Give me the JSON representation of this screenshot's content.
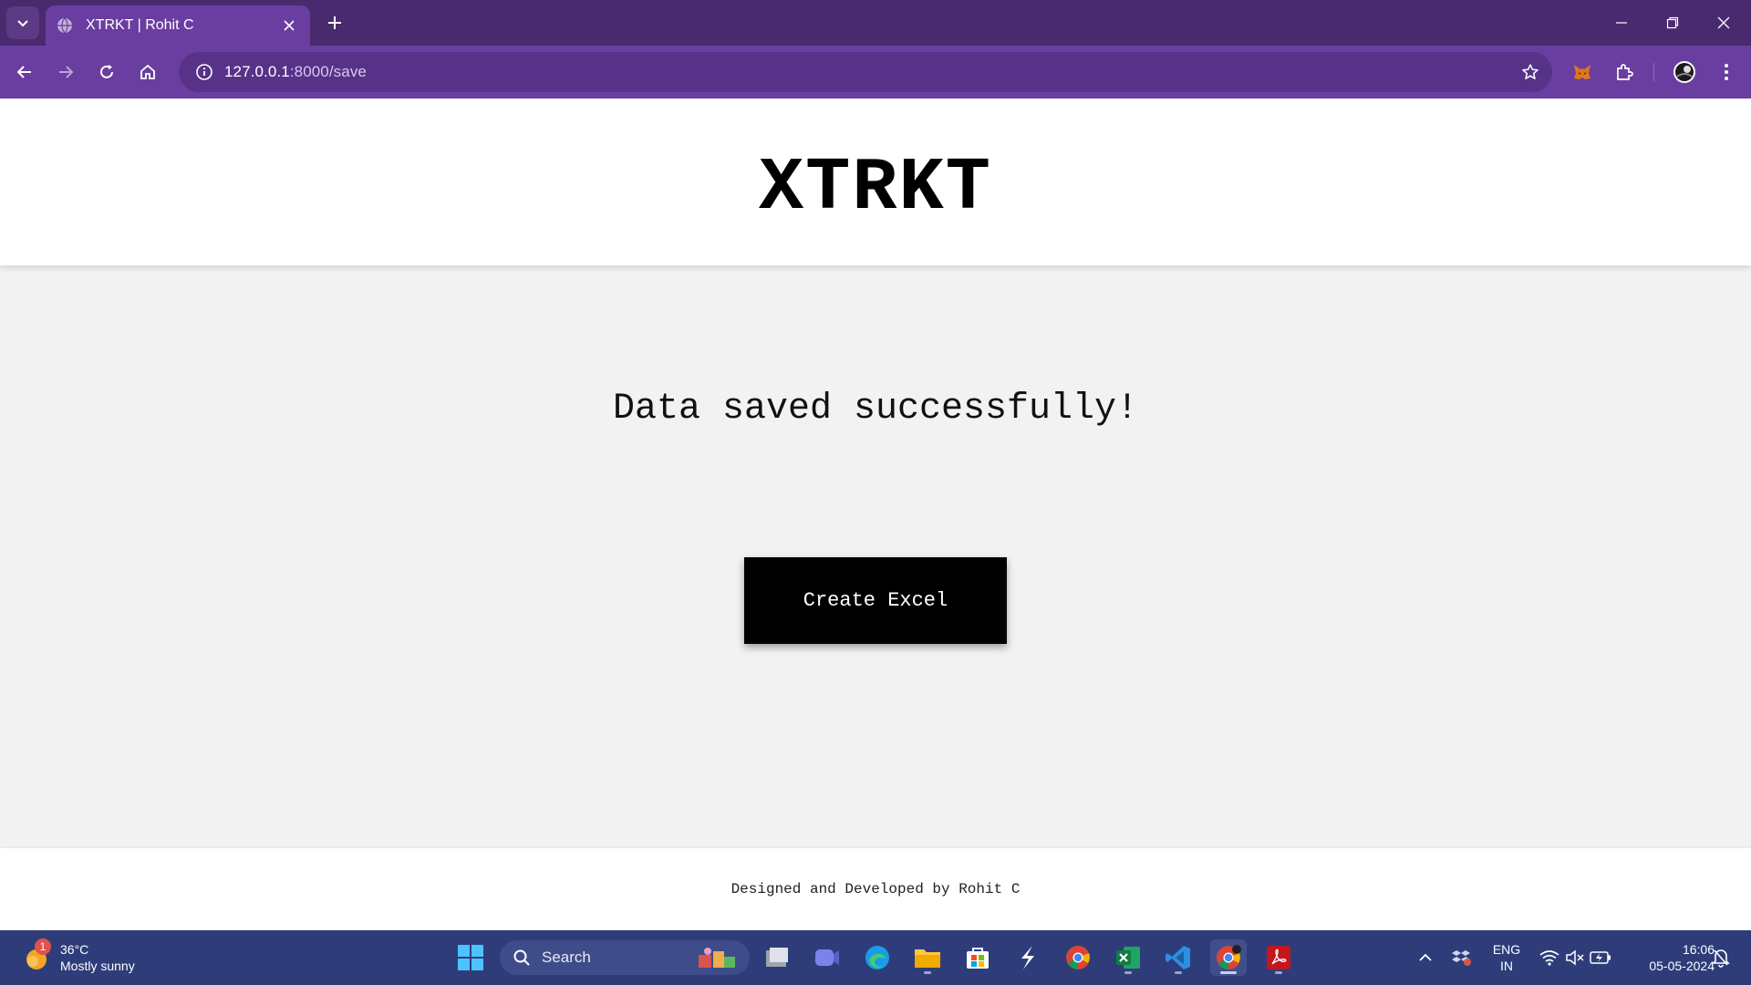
{
  "browser": {
    "tab_title": "XTRKT | Rohit C",
    "url_host": "127.0.0.1",
    "url_path": ":8000/save",
    "theme_colors": {
      "tabstrip": "#4a2a6e",
      "toolbar": "#6a3ea0",
      "omnibox": "#573289"
    },
    "icons": [
      "tab-search-icon",
      "globe-icon",
      "close-icon",
      "plus-icon",
      "minimize-icon",
      "restore-icon",
      "close-window-icon",
      "back-icon",
      "forward-icon",
      "reload-icon",
      "home-icon",
      "site-info-icon",
      "bookmark-star-icon",
      "metamask-extension-icon",
      "extensions-puzzle-icon",
      "profile-avatar-icon",
      "kebab-menu-icon"
    ]
  },
  "page": {
    "logo": "XTRKT",
    "message": "Data saved successfully!",
    "cta_label": "Create Excel",
    "footer": "Designed and Developed by Rohit C"
  },
  "taskbar": {
    "weather": {
      "temp": "36°C",
      "condition": "Mostly sunny",
      "badge": "1"
    },
    "search_placeholder": "Search",
    "apps": [
      "start-icon",
      "task-view-icon",
      "teams-icon",
      "edge-icon",
      "file-explorer-icon",
      "store-icon",
      "app-s-icon",
      "chrome-icon",
      "excel-icon",
      "vscode-icon",
      "chrome-active-icon",
      "acrobat-icon"
    ],
    "lang_top": "ENG",
    "lang_bottom": "IN",
    "time": "16:06",
    "date": "05-05-2024"
  }
}
